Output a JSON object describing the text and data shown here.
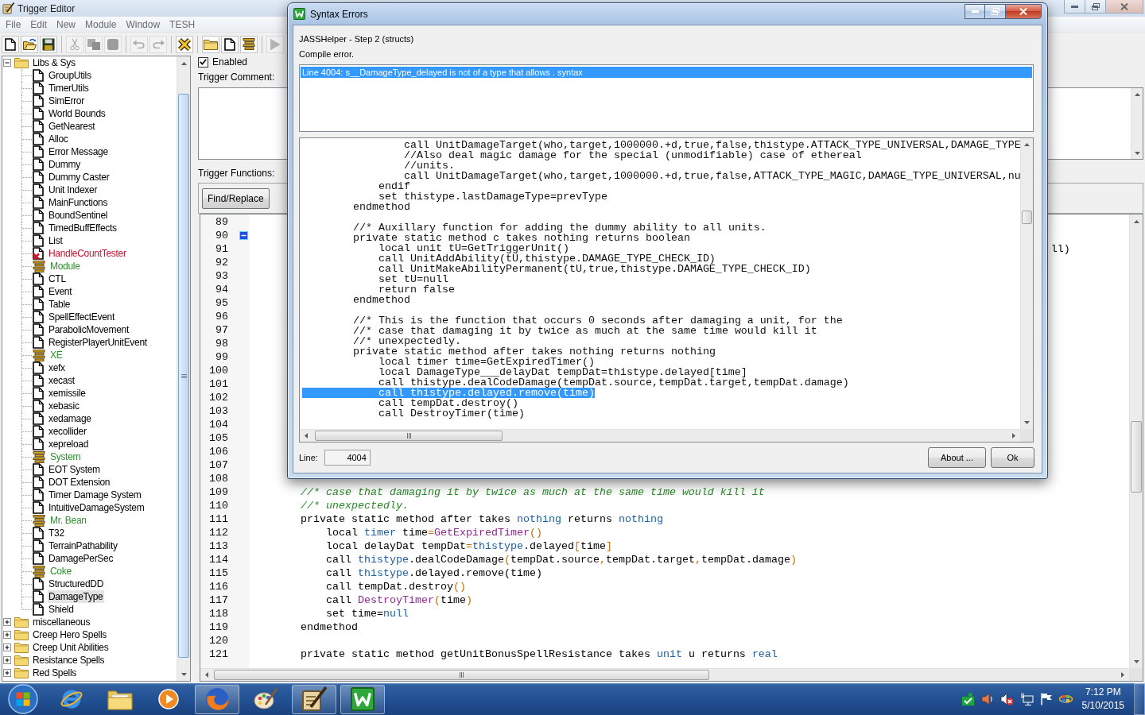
{
  "main_window": {
    "title": "Trigger Editor"
  },
  "menu": [
    "File",
    "Edit",
    "New",
    "Module",
    "Window",
    "TESH"
  ],
  "toolbar": {
    "groups": [
      {
        "buttons": [
          {
            "kind": "new",
            "disabled": false
          },
          {
            "kind": "open",
            "disabled": false
          },
          {
            "kind": "save",
            "disabled": false
          }
        ]
      },
      {
        "buttons": [
          {
            "kind": "cut",
            "disabled": true
          },
          {
            "kind": "copy",
            "disabled": true
          },
          {
            "kind": "paste",
            "disabled": true
          }
        ]
      },
      {
        "buttons": [
          {
            "kind": "undo",
            "disabled": true
          },
          {
            "kind": "redo",
            "disabled": true
          }
        ]
      },
      {
        "buttons": [
          {
            "kind": "mark",
            "disabled": false
          }
        ]
      },
      {
        "buttons": [
          {
            "kind": "category",
            "disabled": false
          },
          {
            "kind": "trigger",
            "disabled": false
          },
          {
            "kind": "comment",
            "disabled": false
          }
        ]
      },
      {
        "buttons": [
          {
            "kind": "test",
            "disabled": true
          }
        ]
      }
    ]
  },
  "tree": [
    {
      "label": "Libs & Sys",
      "kind": "category",
      "expanded": true,
      "selected": false,
      "children": [
        {
          "label": "GroupUtils",
          "kind": "trigger",
          "selected": false
        },
        {
          "label": "TimerUtils",
          "kind": "trigger",
          "selected": false
        },
        {
          "label": "SimError",
          "kind": "trigger",
          "selected": false
        },
        {
          "label": "World Bounds",
          "kind": "trigger",
          "selected": false
        },
        {
          "label": "GetNearest",
          "kind": "trigger",
          "selected": false
        },
        {
          "label": "Alloc",
          "kind": "trigger",
          "selected": false
        },
        {
          "label": "Error Message",
          "kind": "trigger",
          "selected": false
        },
        {
          "label": "Dummy",
          "kind": "trigger",
          "selected": false
        },
        {
          "label": "Dummy Caster",
          "kind": "trigger",
          "selected": false
        },
        {
          "label": "Unit Indexer",
          "kind": "trigger",
          "selected": false
        },
        {
          "label": "MainFunctions",
          "kind": "trigger",
          "selected": false
        },
        {
          "label": "BoundSentinel",
          "kind": "trigger",
          "selected": false
        },
        {
          "label": "TimedBuffEffects",
          "kind": "trigger",
          "selected": false
        },
        {
          "label": "List",
          "kind": "trigger",
          "selected": false
        },
        {
          "label": "HandleCountTester",
          "kind": "disabled",
          "selected": false
        },
        {
          "label": "Module",
          "kind": "comment",
          "selected": false
        },
        {
          "label": "CTL",
          "kind": "trigger",
          "selected": false
        },
        {
          "label": "Event",
          "kind": "trigger",
          "selected": false
        },
        {
          "label": "Table",
          "kind": "trigger",
          "selected": false
        },
        {
          "label": "SpellEffectEvent",
          "kind": "trigger",
          "selected": false
        },
        {
          "label": "ParabolicMovement",
          "kind": "trigger",
          "selected": false
        },
        {
          "label": "RegisterPlayerUnitEvent",
          "kind": "trigger",
          "selected": false
        },
        {
          "label": "XE",
          "kind": "comment",
          "selected": false
        },
        {
          "label": "xefx",
          "kind": "trigger",
          "selected": false
        },
        {
          "label": "xecast",
          "kind": "trigger",
          "selected": false
        },
        {
          "label": "xemissile",
          "kind": "trigger",
          "selected": false
        },
        {
          "label": "xebasic",
          "kind": "trigger",
          "selected": false
        },
        {
          "label": "xedamage",
          "kind": "trigger",
          "selected": false
        },
        {
          "label": "xecollider",
          "kind": "trigger",
          "selected": false
        },
        {
          "label": "xepreload",
          "kind": "trigger",
          "selected": false
        },
        {
          "label": "System",
          "kind": "comment",
          "selected": false
        },
        {
          "label": "EOT System",
          "kind": "trigger",
          "selected": false
        },
        {
          "label": "DOT Extension",
          "kind": "trigger",
          "selected": false
        },
        {
          "label": "Timer Damage System",
          "kind": "trigger",
          "selected": false
        },
        {
          "label": "IntuitiveDamageSystem",
          "kind": "trigger",
          "selected": false
        },
        {
          "label": "Mr. Bean",
          "kind": "comment",
          "selected": false
        },
        {
          "label": "T32",
          "kind": "trigger",
          "selected": false
        },
        {
          "label": "TerrainPathability",
          "kind": "trigger",
          "selected": false
        },
        {
          "label": "DamagePerSec",
          "kind": "trigger",
          "selected": false
        },
        {
          "label": "Coke",
          "kind": "comment",
          "selected": false
        },
        {
          "label": "StructuredDD",
          "kind": "trigger",
          "selected": false
        },
        {
          "label": "DamageType",
          "kind": "trigger",
          "selected": true
        },
        {
          "label": "Shield",
          "kind": "trigger",
          "selected": false
        }
      ]
    },
    {
      "label": "miscellaneous",
      "kind": "category",
      "expanded": false,
      "selected": false
    },
    {
      "label": "Creep Hero Spells",
      "kind": "category",
      "expanded": false,
      "selected": false
    },
    {
      "label": "Creep Unit Abilities",
      "kind": "category",
      "expanded": false,
      "selected": false
    },
    {
      "label": "Resistance Spells",
      "kind": "category",
      "expanded": false,
      "selected": false
    },
    {
      "label": "Red Spells",
      "kind": "category",
      "expanded": false,
      "selected": false
    }
  ],
  "trigger": {
    "enabled": true,
    "enabled_label": "Enabled",
    "comment_label": "Trigger Comment:",
    "functions_label": "Trigger Functions:",
    "find_button": "Find/Replace"
  },
  "editor": {
    "lines": [
      {
        "number": "89",
        "fold_marker": false
      },
      {
        "number": "90",
        "fold_marker": true
      },
      {
        "number": "91",
        "fold_marker": false,
        "tokens": [
          {
            "kind": "plain",
            "text": "                                                                                                                          ll)"
          }
        ]
      },
      {
        "number": "92",
        "fold_marker": false
      },
      {
        "number": "93",
        "fold_marker": false
      },
      {
        "number": "94",
        "fold_marker": false
      },
      {
        "number": "95",
        "fold_marker": false
      },
      {
        "number": "96",
        "fold_marker": false
      },
      {
        "number": "97",
        "fold_marker": false
      },
      {
        "number": "98",
        "fold_marker": false
      },
      {
        "number": "99",
        "fold_marker": false
      },
      {
        "number": "100",
        "fold_marker": false
      },
      {
        "number": "101",
        "fold_marker": false
      },
      {
        "number": "102",
        "fold_marker": false
      },
      {
        "number": "103",
        "fold_marker": false
      },
      {
        "number": "104",
        "fold_marker": false
      },
      {
        "number": "105",
        "fold_marker": false
      },
      {
        "number": "106",
        "fold_marker": false
      },
      {
        "number": "107",
        "fold_marker": false
      },
      {
        "number": "108",
        "fold_marker": false
      },
      {
        "number": "109",
        "fold_marker": false,
        "tokens": [
          {
            "kind": "comment",
            "text": "    //* case that damaging it by twice as much at the same time would kill it"
          }
        ]
      },
      {
        "number": "110",
        "fold_marker": false,
        "tokens": [
          {
            "kind": "comment",
            "text": "    //* unexpectedly."
          }
        ]
      },
      {
        "number": "111",
        "fold_marker": false,
        "tokens": [
          {
            "kind": "plain",
            "text": "    private static method after takes "
          },
          {
            "kind": "type",
            "text": "nothing"
          },
          {
            "kind": "plain",
            "text": " returns "
          },
          {
            "kind": "type",
            "text": "nothing"
          }
        ]
      },
      {
        "number": "112",
        "fold_marker": false,
        "tokens": [
          {
            "kind": "plain",
            "text": "        local "
          },
          {
            "kind": "type",
            "text": "timer"
          },
          {
            "kind": "plain",
            "text": " time"
          },
          {
            "kind": "punct",
            "text": "="
          },
          {
            "kind": "native",
            "text": "GetExpiredTimer"
          },
          {
            "kind": "punct",
            "text": "()"
          }
        ]
      },
      {
        "number": "113",
        "fold_marker": false,
        "tokens": [
          {
            "kind": "plain",
            "text": "        local delayDat tempDat"
          },
          {
            "kind": "punct",
            "text": "="
          },
          {
            "kind": "type",
            "text": "thistype"
          },
          {
            "kind": "plain",
            "text": ".delayed"
          },
          {
            "kind": "punct",
            "text": "["
          },
          {
            "kind": "plain",
            "text": "time"
          },
          {
            "kind": "punct",
            "text": "]"
          }
        ]
      },
      {
        "number": "114",
        "fold_marker": false,
        "tokens": [
          {
            "kind": "plain",
            "text": "        call "
          },
          {
            "kind": "type",
            "text": "thistype"
          },
          {
            "kind": "plain",
            "text": ".dealCodeDamage"
          },
          {
            "kind": "punct",
            "text": "("
          },
          {
            "kind": "plain",
            "text": "tempDat.source"
          },
          {
            "kind": "punct",
            "text": ","
          },
          {
            "kind": "plain",
            "text": "tempDat.target"
          },
          {
            "kind": "punct",
            "text": ","
          },
          {
            "kind": "plain",
            "text": "tempDat.damage"
          },
          {
            "kind": "punct",
            "text": ")"
          }
        ]
      },
      {
        "number": "115",
        "fold_marker": false,
        "tokens": [
          {
            "kind": "plain",
            "text": "        call "
          },
          {
            "kind": "type",
            "text": "thistype"
          },
          {
            "kind": "plain",
            "text": ".delayed.remove(time)"
          }
        ]
      },
      {
        "number": "116",
        "fold_marker": false,
        "tokens": [
          {
            "kind": "plain",
            "text": "        call tempDat.destroy"
          },
          {
            "kind": "punct",
            "text": "()"
          }
        ]
      },
      {
        "number": "117",
        "fold_marker": false,
        "tokens": [
          {
            "kind": "plain",
            "text": "        call "
          },
          {
            "kind": "native",
            "text": "DestroyTimer"
          },
          {
            "kind": "punct",
            "text": "("
          },
          {
            "kind": "plain",
            "text": "time"
          },
          {
            "kind": "punct",
            "text": ")"
          }
        ]
      },
      {
        "number": "118",
        "fold_marker": false,
        "tokens": [
          {
            "kind": "plain",
            "text": "        set time="
          },
          {
            "kind": "type",
            "text": "null"
          }
        ]
      },
      {
        "number": "119",
        "fold_marker": false,
        "tokens": [
          {
            "kind": "plain",
            "text": "    endmethod"
          }
        ]
      },
      {
        "number": "120",
        "fold_marker": false
      },
      {
        "number": "121",
        "fold_marker": false,
        "tokens": [
          {
            "kind": "plain",
            "text": "    private static method getUnitBonusSpellResistance takes "
          },
          {
            "kind": "type",
            "text": "unit"
          },
          {
            "kind": "plain",
            "text": " u returns "
          },
          {
            "kind": "type",
            "text": "real"
          }
        ]
      }
    ]
  },
  "dialog": {
    "title": "Syntax Errors",
    "step": "JASSHelper - Step 2 (structs)",
    "message": "Compile error.",
    "errors": [
      {
        "text": "Line 4004: s__DamageType_delayed is not of a type that allows . syntax",
        "selected": true
      }
    ],
    "code_lines": [
      {
        "text": "                call UnitDamageTarget(who,target,1000000.+d,true,false,thistype.ATTACK_TYPE_UNIVERSAL,DAMAGE_TYPE",
        "selected": false
      },
      {
        "text": "                //Also deal magic damage for the special (unmodifiable) case of ethereal",
        "selected": false
      },
      {
        "text": "                //units.",
        "selected": false
      },
      {
        "text": "                call UnitDamageTarget(who,target,1000000.+d,true,false,ATTACK_TYPE_MAGIC,DAMAGE_TYPE_UNIVERSAL,nu",
        "selected": false
      },
      {
        "text": "            endif",
        "selected": false
      },
      {
        "text": "            set thistype.lastDamageType=prevType",
        "selected": false
      },
      {
        "text": "        endmethod",
        "selected": false
      },
      {
        "selected": false
      },
      {
        "text": "        //* Auxillary function for adding the dummy ability to all units.",
        "selected": false
      },
      {
        "text": "        private static method c takes nothing returns boolean",
        "selected": false
      },
      {
        "text": "            local unit tU=GetTriggerUnit()",
        "selected": false
      },
      {
        "text": "            call UnitAddAbility(tU,thistype.DAMAGE_TYPE_CHECK_ID)",
        "selected": false
      },
      {
        "text": "            call UnitMakeAbilityPermanent(tU,true,thistype.DAMAGE_TYPE_CHECK_ID)",
        "selected": false
      },
      {
        "text": "            set tU=null",
        "selected": false
      },
      {
        "text": "            return false",
        "selected": false
      },
      {
        "text": "        endmethod",
        "selected": false
      },
      {
        "selected": false
      },
      {
        "text": "        //* This is the function that occurs 0 seconds after damaging a unit, for the",
        "selected": false
      },
      {
        "text": "        //* case that damaging it by twice as much at the same time would kill it",
        "selected": false
      },
      {
        "text": "        //* unexpectedly.",
        "selected": false
      },
      {
        "text": "        private static method after takes nothing returns nothing",
        "selected": false
      },
      {
        "text": "            local timer time=GetExpiredTimer()",
        "selected": false
      },
      {
        "text": "            local DamageType___delayDat tempDat=thistype.delayed[time]",
        "selected": false
      },
      {
        "text": "            call thistype.dealCodeDamage(tempDat.source,tempDat.target,tempDat.damage)",
        "selected": false
      },
      {
        "text": "            call thistype.delayed.remove(time)",
        "selected": true
      },
      {
        "text": "            call tempDat.destroy()",
        "selected": false
      },
      {
        "text": "            call DestroyTimer(time)",
        "selected": false
      }
    ],
    "line_label": "Line:",
    "line_value": "4004",
    "buttons": [
      "About ...",
      "Ok"
    ]
  },
  "taskbar": {
    "apps": [
      {
        "kind": "browser",
        "running": false
      },
      {
        "kind": "files",
        "running": false
      },
      {
        "kind": "media",
        "running": false
      },
      {
        "kind": "fox",
        "running": true
      },
      {
        "kind": "paint",
        "running": false
      },
      {
        "kind": "editor",
        "running": true
      },
      {
        "kind": "jass",
        "running": true
      }
    ],
    "time": "7:12 PM",
    "date": "5/10/2015"
  }
}
